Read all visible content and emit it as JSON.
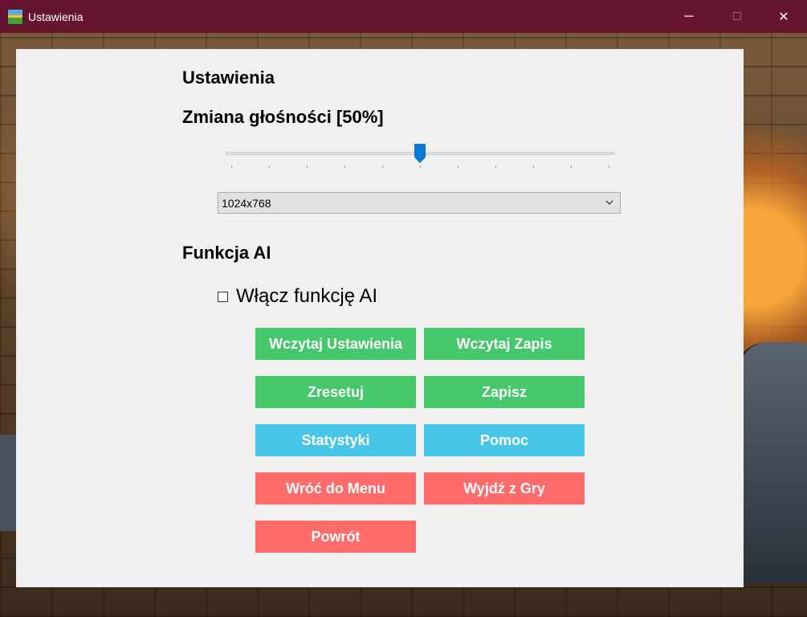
{
  "window": {
    "title": "Ustawienia",
    "controls": {
      "minimize": "─",
      "maximize": "□",
      "close": "✕"
    }
  },
  "settings": {
    "heading": "Ustawienia",
    "volume": {
      "label": "Zmiana głośności [50%]",
      "value_percent": 50,
      "min": 0,
      "max": 100,
      "tick_count": 11
    },
    "resolution": {
      "selected": "1024x768"
    },
    "ai": {
      "heading": "Funkcja AI",
      "checkbox_label": "Włącz funkcję AI",
      "checked": false
    },
    "buttons": {
      "load_settings": "Wczytaj Ustawienia",
      "load_save": "Wczytaj Zapis",
      "reset": "Zresetuj",
      "save": "Zapisz",
      "stats": "Statystyki",
      "help": "Pomoc",
      "back_to_menu": "Wróć do Menu",
      "exit_game": "Wyjdź z Gry",
      "return": "Powrót"
    }
  },
  "colors": {
    "titlebar": "#66142f",
    "panel": "#f0f0f0",
    "button_green": "#45c86b",
    "button_blue": "#46c5e8",
    "button_red": "#fd6b6b",
    "slider_accent": "#0a78d7"
  }
}
